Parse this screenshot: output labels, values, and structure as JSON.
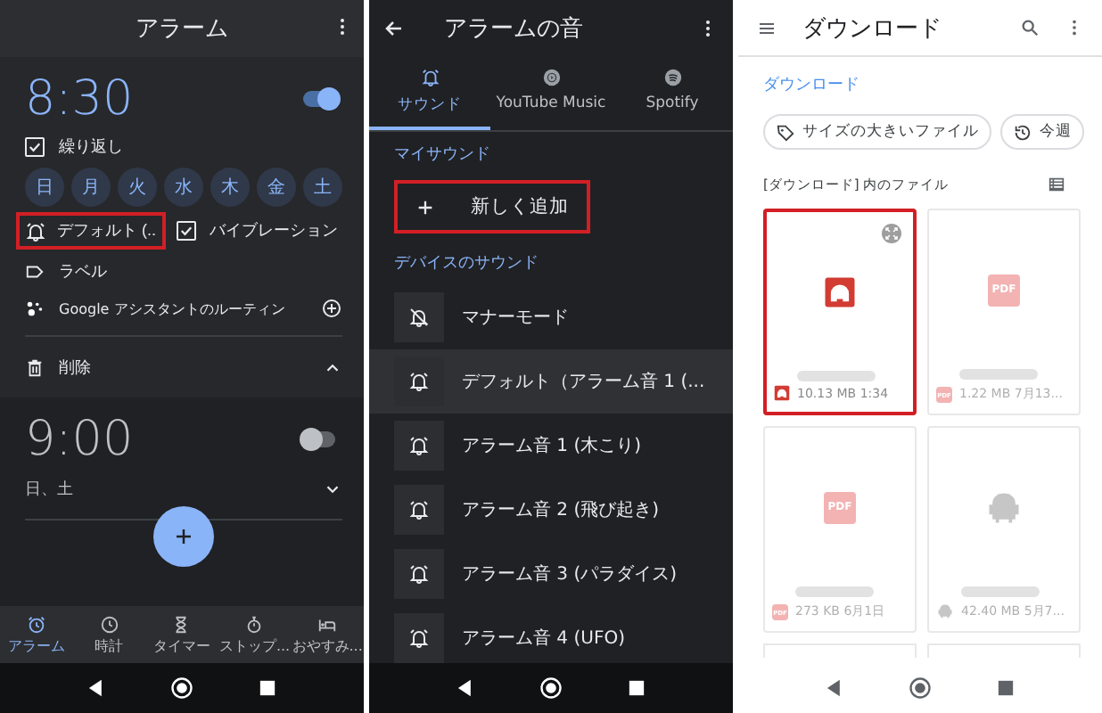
{
  "alarm_screen": {
    "title": "アラーム",
    "alarms": [
      {
        "time": "8:30",
        "enabled": true,
        "expanded": true,
        "repeat": {
          "label": "繰り返し",
          "checked": true
        },
        "days": [
          {
            "label": "日",
            "selected": false
          },
          {
            "label": "月",
            "selected": false
          },
          {
            "label": "火",
            "selected": false
          },
          {
            "label": "水",
            "selected": false
          },
          {
            "label": "木",
            "selected": false
          },
          {
            "label": "金",
            "selected": false
          },
          {
            "label": "土",
            "selected": false
          }
        ],
        "sound": {
          "label": "デフォルト (..",
          "highlighted": true
        },
        "vibration": {
          "label": "バイブレーション",
          "checked": true
        },
        "label": "ラベル",
        "assistant": "Google アシスタントのルーティン",
        "delete": "削除"
      },
      {
        "time": "9:00",
        "enabled": false,
        "expanded": false,
        "summary": "日、土"
      }
    ],
    "bottom_tabs": [
      {
        "label": "アラーム",
        "kind": "alarm",
        "selected": true
      },
      {
        "label": "時計",
        "kind": "clock",
        "selected": false
      },
      {
        "label": "タイマー",
        "kind": "timer",
        "selected": false
      },
      {
        "label": "ストップ...",
        "kind": "stopwatch",
        "selected": false
      },
      {
        "label": "おやすみ...",
        "kind": "bedtime",
        "selected": false
      }
    ]
  },
  "sound_screen": {
    "title": "アラームの音",
    "tabs": [
      {
        "label": "サウンド",
        "kind": "bell",
        "selected": true
      },
      {
        "label": "YouTube Music",
        "kind": "play",
        "selected": false
      },
      {
        "label": "Spotify",
        "kind": "spotify",
        "selected": false
      }
    ],
    "my_sounds_heading": "マイサウンド",
    "add": {
      "label": "新しく追加",
      "highlighted": true
    },
    "device_sounds_heading": "デバイスのサウンド",
    "sounds": [
      {
        "label": "マナーモード",
        "kind": "silent",
        "selected": false
      },
      {
        "label": "デフォルト（アラーム音 1 (...",
        "kind": "bell",
        "selected": true
      },
      {
        "label": "アラーム音 1 (木こり)",
        "kind": "bell",
        "selected": false
      },
      {
        "label": "アラーム音 2 (飛び起き)",
        "kind": "bell",
        "selected": false
      },
      {
        "label": "アラーム音 3 (パラダイス)",
        "kind": "bell",
        "selected": false
      },
      {
        "label": "アラーム音 4 (UFO)",
        "kind": "bell",
        "selected": false
      }
    ]
  },
  "files_screen": {
    "title": "ダウンロード",
    "breadcrumb": "ダウンロード",
    "chips": [
      {
        "label": "サイズの大きいファイル",
        "kind": "tag"
      },
      {
        "label": "今週",
        "kind": "history"
      }
    ],
    "section_title": "[ダウンロード] 内のファイル",
    "files": [
      {
        "kind": "audio",
        "meta": "10.13 MB 1:34",
        "highlighted": true
      },
      {
        "kind": "pdf",
        "thumb_badge": "PDF",
        "badge": "PDF",
        "meta": "1.22 MB 7月13...",
        "highlighted": false
      },
      {
        "kind": "pdf",
        "thumb_badge": "PDF",
        "badge": "PDF",
        "meta": "273 KB 6月1日",
        "highlighted": false
      },
      {
        "kind": "apk",
        "meta": "42.40 MB 5月7...",
        "highlighted": false
      }
    ]
  }
}
